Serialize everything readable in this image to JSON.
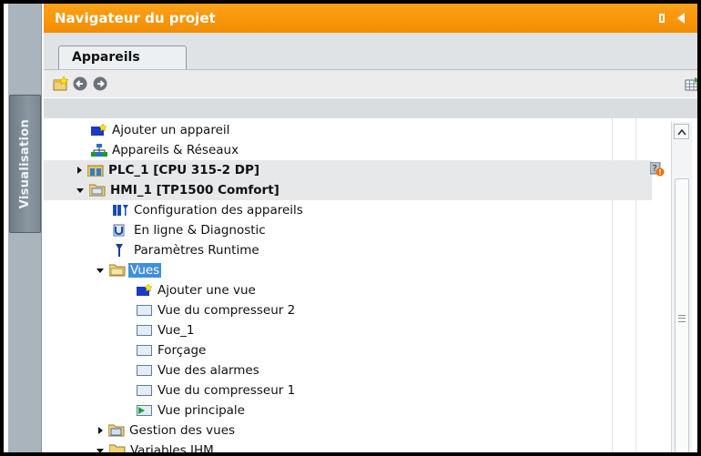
{
  "sidebar": {
    "vertical_tab": "Visualisation"
  },
  "header": {
    "title": "Navigateur du projet"
  },
  "tabs": [
    {
      "label": "Appareils"
    }
  ],
  "toolbar": {
    "icons": [
      "new-device-icon",
      "back-icon",
      "forward-icon",
      "table-view-icon"
    ]
  },
  "tree": {
    "items": [
      {
        "label": "Ajouter un appareil",
        "icon": "add-device-icon"
      },
      {
        "label": "Appareils & Réseaux",
        "icon": "network-icon"
      },
      {
        "label": "PLC_1 [CPU 315-2 DP]",
        "icon": "plc-icon"
      },
      {
        "label": "HMI_1 [TP1500 Comfort]",
        "icon": "hmi-icon"
      },
      {
        "label": "Configuration des appareils",
        "icon": "device-config-icon"
      },
      {
        "label": "En ligne & Diagnostic",
        "icon": "diagnostic-icon"
      },
      {
        "label": "Paramètres Runtime",
        "icon": "runtime-icon"
      },
      {
        "label": "Vues",
        "icon": "folder-icon"
      },
      {
        "label": "Ajouter une vue",
        "icon": "add-screen-icon"
      },
      {
        "label": "Vue du compresseur 2",
        "icon": "screen-icon"
      },
      {
        "label": "Vue_1",
        "icon": "screen-icon"
      },
      {
        "label": "Forçage",
        "icon": "screen-icon"
      },
      {
        "label": "Vue des alarmes",
        "icon": "screen-icon"
      },
      {
        "label": "Vue du compresseur 1",
        "icon": "screen-icon"
      },
      {
        "label": "Vue principale",
        "icon": "start-screen-icon"
      },
      {
        "label": "Gestion des vues",
        "icon": "folder-icon"
      },
      {
        "label": "Variables IHM",
        "icon": "folder-icon"
      }
    ]
  },
  "colors": {
    "accent": "#f39200",
    "selection": "#3f8fdc"
  }
}
